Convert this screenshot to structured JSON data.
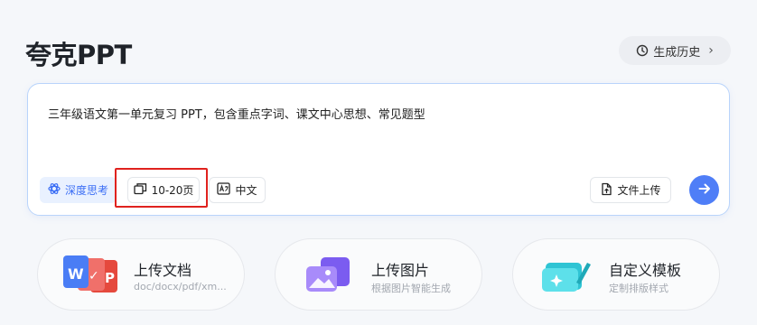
{
  "header": {
    "title": "夸克PPT",
    "history_label": "生成历史",
    "history_chevron": "›"
  },
  "input": {
    "prompt": "三年级语文第一单元复习 PPT，包含重点字词、课文中心思想、常见题型",
    "options": {
      "deep_think": "深度思考",
      "page_range": "10-20页",
      "language": "中文"
    },
    "upload_label": "文件上传"
  },
  "features": [
    {
      "title": "上传文档",
      "subtitle": "doc/docx/pdf/xm..."
    },
    {
      "title": "上传图片",
      "subtitle": "根据图片智能生成"
    },
    {
      "title": "自定义模板",
      "subtitle": "定制排版样式"
    }
  ],
  "colors": {
    "accent": "#4f7ef7",
    "highlight": "#e0221e",
    "deep_think_bg": "#e9f1ff"
  },
  "icons": [
    "clock-icon",
    "atom-icon",
    "pages-icon",
    "translate-icon",
    "file-upload-icon",
    "arrow-right-icon",
    "document-formats-icon",
    "image-upload-icon",
    "template-edit-icon"
  ]
}
